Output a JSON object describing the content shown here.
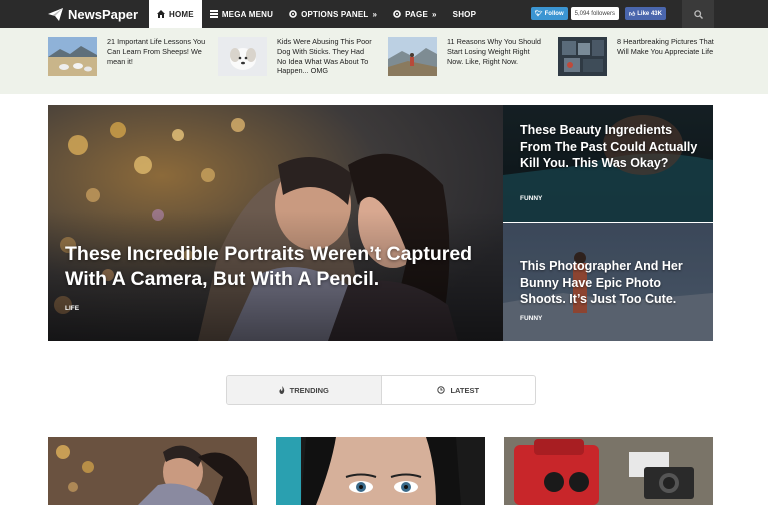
{
  "logo": {
    "text": "NewsPaper",
    "icon": "paper-plane-icon"
  },
  "nav": {
    "items": [
      {
        "label": "HOME",
        "icon": "home-icon",
        "active": true
      },
      {
        "label": "MEGA MENU",
        "icon": "grid-icon"
      },
      {
        "label": "OPTIONS PANEL",
        "icon": "gear-icon",
        "caret": "»"
      },
      {
        "label": "PAGE",
        "icon": "gear-icon",
        "caret": "»"
      },
      {
        "label": "SHOP"
      }
    ],
    "twitter_label": "Follow",
    "twitter_count": "5,094 followers",
    "facebook_label": "Like 43K",
    "search_icon": "search-icon"
  },
  "ticker": [
    {
      "title": "21 Important Life Lessons You Can Learn From Sheeps! We mean it!"
    },
    {
      "title": "Kids Were Abusing This Poor Dog With Sticks. They Had No Idea What Was About To Happen... OMG"
    },
    {
      "title": "11 Reasons Why You Should Start Losing Weight Right Now. Like, Right Now."
    },
    {
      "title": "8 Heartbreaking Pictures That Will Make You Appreciate Life"
    }
  ],
  "hero": {
    "main": {
      "title": "These Incredible Portraits Weren’t Captured With A Camera, But With A Pencil.",
      "category": "LIFE"
    },
    "side": [
      {
        "title": "These Beauty Ingredients From The Past Could Actually Kill You. This Was Okay?",
        "category": "FUNNY"
      },
      {
        "title": "This Photographer And Her Bunny Have Epic Photo Shoots. It’s Just Too Cute.",
        "category": "FUNNY"
      }
    ]
  },
  "tabs": [
    {
      "label": "TRENDING",
      "icon": "flame-icon",
      "active": true
    },
    {
      "label": "LATEST",
      "icon": "clock-icon"
    }
  ],
  "colors": {
    "nav_bg": "#2b2b2b",
    "strip_bg": "#eef2ea",
    "twitter": "#3b95d2",
    "facebook": "#4a66ad"
  }
}
